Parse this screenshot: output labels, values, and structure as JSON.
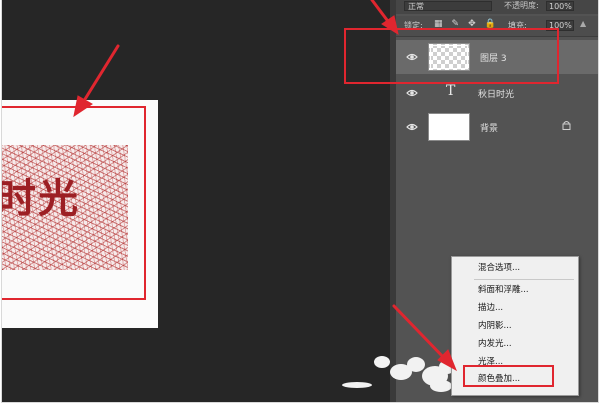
{
  "options_bar": {
    "blend_mode": "正常",
    "opacity_label": "不透明度:",
    "opacity_value": "100%",
    "lock_label": "锁定:",
    "fill_label": "填充:",
    "fill_value": "100%"
  },
  "canvas": {
    "document_text": "时光"
  },
  "layers": [
    {
      "name": "图层 3",
      "kind": "pixel",
      "thumb": "transparent-checker",
      "selected": true
    },
    {
      "name": "秋日时光",
      "kind": "text",
      "glyph": "T"
    },
    {
      "name": "背景",
      "kind": "background",
      "thumb": "white",
      "locked": true
    }
  ],
  "context_menu": {
    "items": [
      "混合选项...",
      "斜面和浮雕...",
      "描边...",
      "内阴影...",
      "内发光...",
      "光泽...",
      "颜色叠加..."
    ],
    "highlighted": "颜色叠加..."
  },
  "colors": {
    "annotation_red": "#e0262f",
    "panel_bg": "#535353",
    "canvas_bg": "#262626"
  }
}
